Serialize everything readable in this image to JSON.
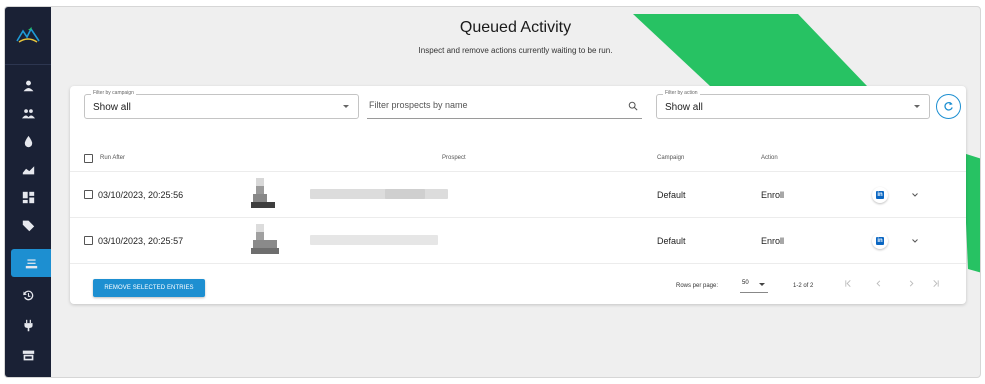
{
  "sidebar": {
    "logo": "logo-mountain-bird",
    "items": [
      {
        "name": "sidebar-item-profile",
        "icon": "person-icon"
      },
      {
        "name": "sidebar-item-prospects",
        "icon": "group-icon"
      },
      {
        "name": "sidebar-item-drip",
        "icon": "water-drop-icon"
      },
      {
        "name": "sidebar-item-analytics",
        "icon": "area-chart-icon"
      },
      {
        "name": "sidebar-item-dashboard",
        "icon": "dashboard-icon"
      },
      {
        "name": "sidebar-item-tags",
        "icon": "tag-icon"
      },
      {
        "name": "sidebar-item-queue",
        "icon": "queue-icon",
        "active": true
      },
      {
        "name": "sidebar-item-history",
        "icon": "history-icon"
      },
      {
        "name": "sidebar-item-integrations",
        "icon": "plug-icon"
      },
      {
        "name": "sidebar-item-store",
        "icon": "storefront-icon"
      }
    ]
  },
  "header": {
    "title": "Queued Activity",
    "subtitle": "Inspect and remove actions currently waiting to be run."
  },
  "filters": {
    "campaign": {
      "label": "Filter by campaign",
      "value": "Show all"
    },
    "name": {
      "placeholder": "Filter prospects by name"
    },
    "action": {
      "label": "Filter by action",
      "value": "Show all"
    }
  },
  "table": {
    "headers": {
      "run_after": "Run After",
      "prospect": "Prospect",
      "campaign": "Campaign",
      "action": "Action"
    },
    "rows": [
      {
        "run_after": "03/10/2023, 20:25:56",
        "campaign": "Default",
        "action": "Enroll"
      },
      {
        "run_after": "03/10/2023, 20:25:57",
        "campaign": "Default",
        "action": "Enroll"
      }
    ]
  },
  "footer": {
    "remove_label": "REMOVE SELECTED ENTRIES",
    "rows_per_page_label": "Rows per page:",
    "rows_per_page_value": "50",
    "range": "1-2 of 2"
  },
  "colors": {
    "sidebar": "#1a2135",
    "accent": "#1d8fd1",
    "green": "#27c263",
    "linkedin": "#0a66c2"
  }
}
